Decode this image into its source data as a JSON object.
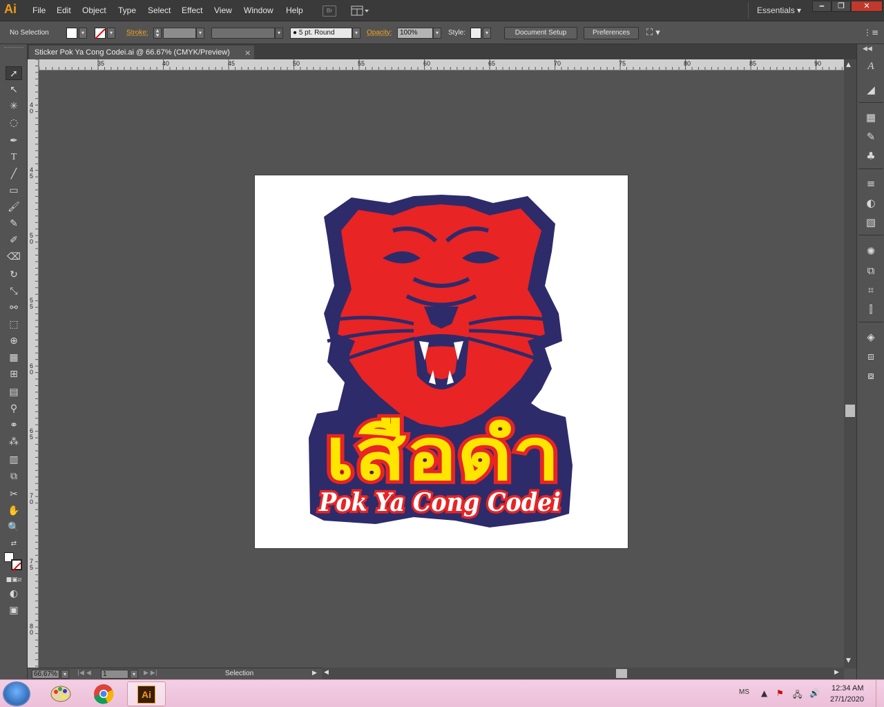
{
  "app": {
    "logo": "Ai"
  },
  "menu": [
    "File",
    "Edit",
    "Object",
    "Type",
    "Select",
    "Effect",
    "View",
    "Window",
    "Help"
  ],
  "menubar": {
    "bridge_label": "Br",
    "workspace": "Essentials"
  },
  "window_controls": {
    "minimize": "‒",
    "restore": "❐",
    "close": "✕"
  },
  "control_bar": {
    "selection": "No Selection",
    "stroke_label": "Stroke:",
    "brush": "5 pt. Round",
    "opacity_label": "Opacity:",
    "opacity_value": "100%",
    "style_label": "Style:",
    "document_setup": "Document Setup",
    "preferences": "Preferences"
  },
  "document": {
    "tab_title": "Sticker Pok Ya Cong Codei.ai @ 66.67% (CMYK/Preview)",
    "close_label": "×"
  },
  "ruler_h": [
    "35",
    "40",
    "45",
    "50",
    "55",
    "60",
    "65",
    "70",
    "75",
    "80",
    "85",
    "90"
  ],
  "ruler_v": [
    "40",
    "45",
    "50",
    "55",
    "60",
    "65",
    "70",
    "75",
    "80"
  ],
  "artwork": {
    "thai_title": "เสือดำ",
    "subtitle": "Pok Ya Cong Codei",
    "colors": {
      "navy": "#2e2b6b",
      "red": "#e82424",
      "yellow": "#ffe600",
      "white": "#ffffff"
    }
  },
  "status_bar": {
    "zoom": "66.67%",
    "page": "1",
    "tool": "Selection"
  },
  "taskbar": {
    "ai_label": "Ai",
    "lang": "MS",
    "time": "12:34 AM",
    "date": "27/1/2020"
  },
  "theme": {
    "accent_orange": "#f5a623",
    "panel": "#535353",
    "dark": "#3a3a3a"
  }
}
